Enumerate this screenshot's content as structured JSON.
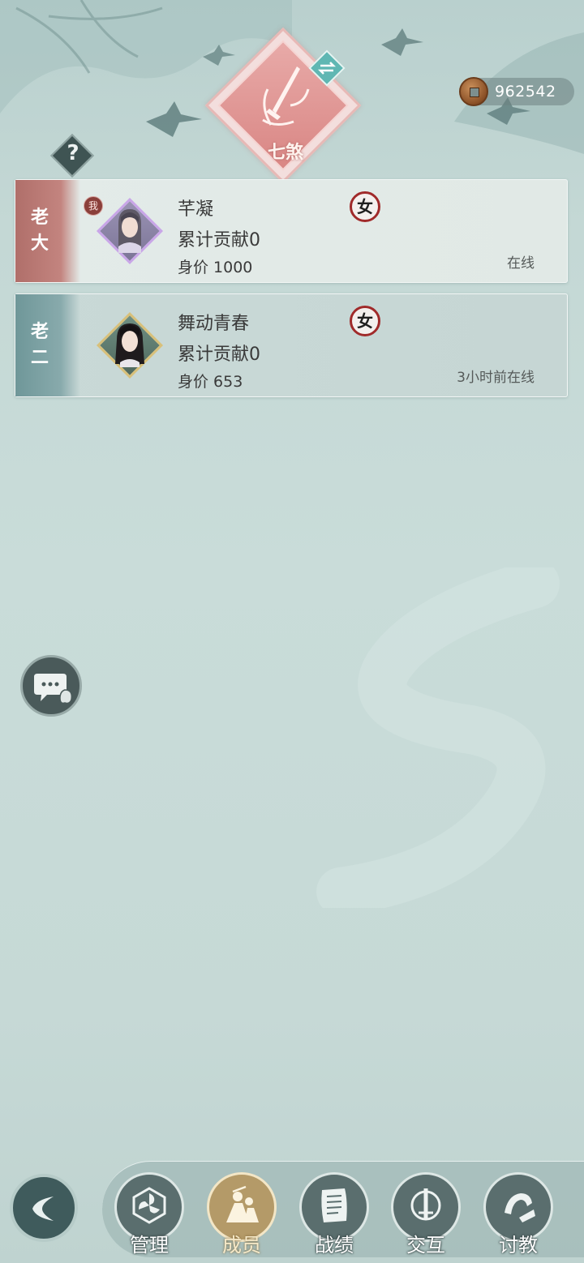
{
  "header": {
    "coins": "962542",
    "guild_emblem_text": "七煞",
    "help_label": "?"
  },
  "members": [
    {
      "rank": "老大",
      "is_self_badge": "我",
      "name": "芊凝",
      "gender": "女",
      "contribution": "累计贡献0",
      "worth": "身价 1000",
      "status": "在线"
    },
    {
      "rank": "老二",
      "name": "舞动青春",
      "gender": "女",
      "contribution": "累计贡献0",
      "worth": "身价 653",
      "status": "3小时前在线"
    }
  ],
  "nav": {
    "items": [
      {
        "label": "管理",
        "icon": "pinwheel-icon",
        "active": false
      },
      {
        "label": "成员",
        "icon": "members-icon",
        "active": true
      },
      {
        "label": "战绩",
        "icon": "scroll-icon",
        "active": false
      },
      {
        "label": "交互",
        "icon": "sword-icon",
        "active": false
      },
      {
        "label": "讨教",
        "icon": "fist-icon",
        "active": false
      }
    ]
  },
  "colors": {
    "rank1_tab": "#b06f6a",
    "rank2_tab": "#6f9799",
    "active_nav": "#b49a68",
    "gender_ring": "#a02a2a"
  }
}
